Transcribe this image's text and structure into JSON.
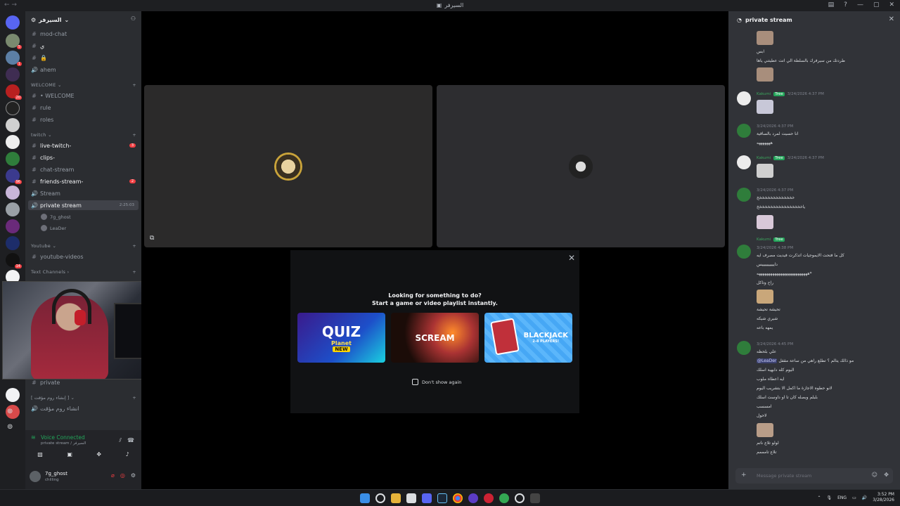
{
  "window": {
    "title": "السيرفر"
  },
  "server": {
    "name": "السيرفر",
    "rail_badges": [
      "5",
      "1",
      "4",
      "1",
      "20",
      "1",
      "96",
      "5",
      "14"
    ]
  },
  "channels": {
    "top": [
      {
        "name": "mod-chat",
        "icon": "#"
      },
      {
        "name": "ي",
        "icon": "#"
      },
      {
        "name": "🔒",
        "icon": "#"
      },
      {
        "name": "ahem",
        "icon": "🔊"
      }
    ],
    "welcome_cat": "WELCOME",
    "welcome": [
      {
        "name": "• WELCOME",
        "icon": "#"
      },
      {
        "name": "rule",
        "icon": "#"
      },
      {
        "name": "roles",
        "icon": "#"
      }
    ],
    "twitch_cat": "twitch",
    "twitch": [
      {
        "name": "live-twitch-",
        "icon": "#",
        "badge": "3"
      },
      {
        "name": "clips-",
        "icon": "#"
      },
      {
        "name": "chat-stream",
        "icon": "#"
      },
      {
        "name": "friends-stream-",
        "icon": "#",
        "badge": "2"
      },
      {
        "name": "Stream",
        "icon": "🔊"
      },
      {
        "name": "private stream",
        "icon": "🔊",
        "timer": "2:25:03"
      }
    ],
    "voice_users": [
      "7g_ghost",
      "LeaDer"
    ],
    "youtube_cat": "Youtube",
    "youtube": [
      {
        "name": "youtube-videos",
        "icon": "#"
      }
    ],
    "text_cat": "Text Channels",
    "bottom": [
      {
        "name": "private",
        "icon": "#"
      }
    ],
    "misc_cat": "[ إنشاء روم مؤقت ]",
    "misc": [
      {
        "name": "انشاء روم مؤقت",
        "icon": "🔊"
      }
    ]
  },
  "voice": {
    "status": "Voice Connected",
    "location": "private stream / السيرفر"
  },
  "user": {
    "name": "7g_ghost",
    "status": "chilling"
  },
  "activity": {
    "line1": "Looking for something to do?",
    "line2": "Start a game or video playlist instantly.",
    "cards": [
      {
        "title": "QUIZ",
        "sub": "Planet",
        "badge": "NEW"
      },
      {
        "title": "SCREAM"
      },
      {
        "title": "BLACKJACK",
        "sub": "2-8 PLAYERS!"
      }
    ],
    "checkbox": "Don't show again"
  },
  "chat": {
    "title": "private stream",
    "messages": [
      {
        "kind": "text",
        "text": "ابس"
      },
      {
        "kind": "text",
        "text": "طردتك من سيرفرك بالسلطة الي انت عطيتني ياها"
      },
      {
        "kind": "meta",
        "nick": "Kakumi",
        "tag": "Tree",
        "time": "3/24/2026 4:37 PM"
      },
      {
        "kind": "meta",
        "nick": "",
        "tag": "",
        "time": "3/24/2026 4:37 PM"
      },
      {
        "kind": "text",
        "text": "انا حسيت لمرد بالساقية"
      },
      {
        "kind": "text",
        "text": "هههههههه"
      },
      {
        "kind": "meta",
        "nick": "Kakumi",
        "tag": "Tree",
        "time": "3/24/2026 4:37 PM"
      },
      {
        "kind": "meta",
        "nick": "",
        "tag": "",
        "time": "3/24/2026 4:37 PM"
      },
      {
        "kind": "text",
        "text": "خخخخخخخخخخخخخخ"
      },
      {
        "kind": "text",
        "text": "ياخخخخخخخخخخخخخخخخخ"
      },
      {
        "kind": "meta",
        "nick": "Kakumi",
        "tag": "Tree",
        "time": "3/24/2026 4:38 PM"
      },
      {
        "kind": "text",
        "text": "كل ما فتحت الايموجيات اتذكرت فيديت مصرف ايه"
      },
      {
        "kind": "text",
        "text": "داييييييييييس"
      },
      {
        "kind": "text",
        "text": "*ههههههههههههههههههههههههههه"
      },
      {
        "kind": "text",
        "text": "راح وتاكل"
      },
      {
        "kind": "text",
        "text": "تحيشة تحيشة"
      },
      {
        "kind": "text",
        "text": "شيري شيكه"
      },
      {
        "kind": "text",
        "text": "يمهه باعه"
      },
      {
        "kind": "meta",
        "nick": "",
        "tag": "",
        "time": "3/24/2026 4:45 PM"
      },
      {
        "kind": "text",
        "text": "علي بلحظه"
      },
      {
        "kind": "mention",
        "text": "مو ذالك يتالم ؟ تطلع راهي من ساعة مقفل",
        "mention": "@LeaDer"
      },
      {
        "kind": "text",
        "text": "اليوم كله دابهية اسلك"
      },
      {
        "kind": "text",
        "text": "ايه اعطاه ملوب"
      },
      {
        "kind": "text",
        "text": "لانو حطوه الاجازة ما اكمل الا بتشريب اليوم"
      },
      {
        "kind": "text",
        "text": "بلبلم وبصله كان تا او داوست اسلك"
      },
      {
        "kind": "text",
        "text": "امسسب"
      },
      {
        "kind": "text",
        "text": "لاحول"
      },
      {
        "kind": "text",
        "text": "لولو تلاع ناتم"
      },
      {
        "kind": "text",
        "text": "تلاع تامممم"
      }
    ],
    "placeholder": "Message private stream"
  },
  "tray": {
    "lang": "ENG",
    "time": "3:52 PM",
    "date": "3/28/2026"
  }
}
